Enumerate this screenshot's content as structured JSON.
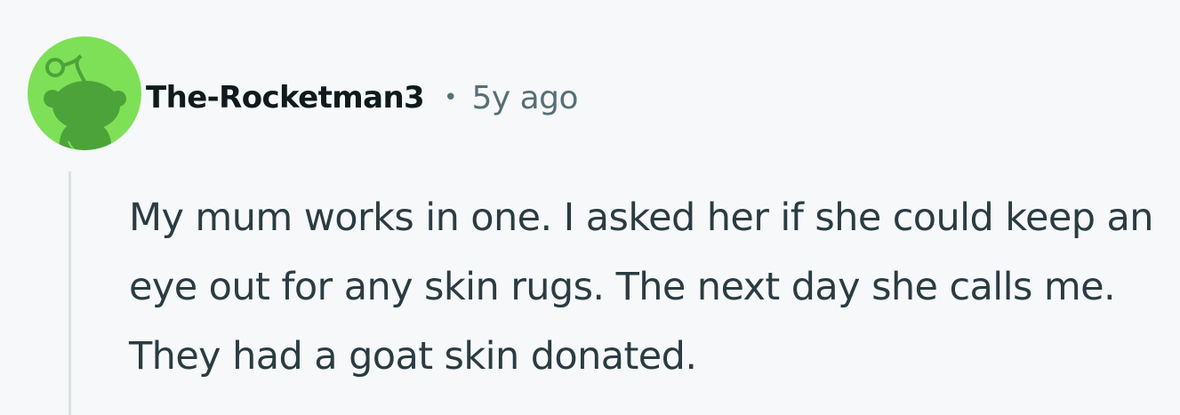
{
  "comment": {
    "author": "The-Rocketman3",
    "separator": "•",
    "timestamp": "5y ago",
    "avatar_icon": "snoo-avatar-icon",
    "text": "My mum works in one. I asked her if she could keep an eye out for any skin rugs. The next day she calls me. They had a goat skin donated."
  },
  "colors": {
    "background": "#f6f8fa",
    "avatar_bg": "#7ee056",
    "avatar_figure": "#4ca33a",
    "author": "#0f1a1c",
    "meta": "#576f76",
    "body": "#2a3c42",
    "thread_line": "#dbe0e4"
  }
}
